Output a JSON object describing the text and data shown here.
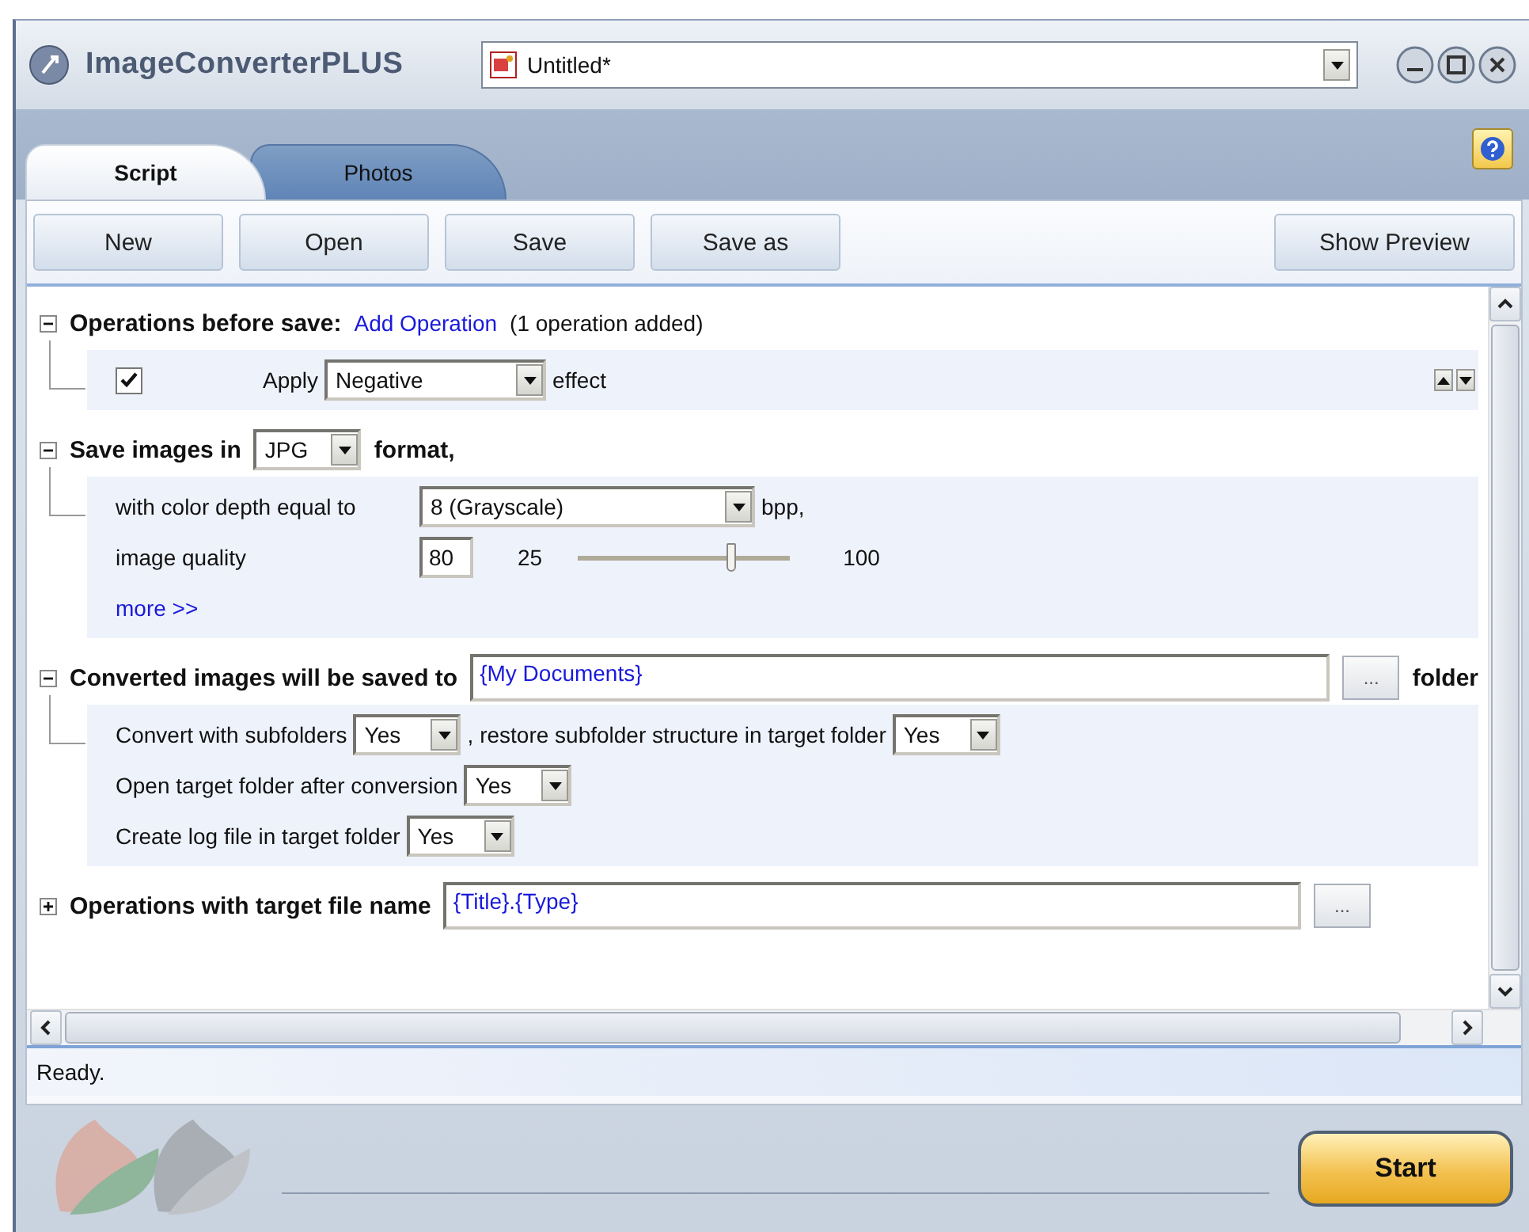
{
  "window": {
    "app_name": "ImageConverterPLUS",
    "document": "Untitled*"
  },
  "tabs": [
    {
      "label": "Script",
      "selected": true
    },
    {
      "label": "Photos",
      "selected": false
    }
  ],
  "toolbar": {
    "buttons": [
      "New",
      "Open",
      "Save",
      "Save as"
    ],
    "preview_button": "Show Preview"
  },
  "sections": [
    {
      "expanded": true,
      "header": [
        {
          "kind": "bold",
          "text": "Operations before save:"
        },
        {
          "kind": "link",
          "text": "Add Operation"
        },
        {
          "kind": "text",
          "text": "(1 operation added)"
        }
      ],
      "options": [
        {
          "items": [
            {
              "kind": "checkbox",
              "checked": true
            },
            {
              "kind": "text",
              "text": "Apply"
            },
            {
              "kind": "select",
              "value": "Negative"
            },
            {
              "kind": "text",
              "text": "effect"
            },
            {
              "kind": "reorder"
            }
          ]
        }
      ]
    },
    {
      "expanded": true,
      "header": [
        {
          "kind": "bold",
          "text": "Save images in"
        },
        {
          "kind": "select",
          "value": "JPG"
        },
        {
          "kind": "bold",
          "text": "format,"
        }
      ],
      "options": [
        {
          "items": [
            {
              "kind": "label",
              "text": "with color depth equal to"
            },
            {
              "kind": "select",
              "value": "8 (Grayscale)"
            },
            {
              "kind": "text",
              "text": "bpp,"
            }
          ]
        },
        {
          "items": [
            {
              "kind": "label",
              "text": "image quality"
            },
            {
              "kind": "input",
              "value": "80"
            },
            {
              "kind": "text",
              "text": "25"
            },
            {
              "kind": "slider",
              "level": 0.73
            },
            {
              "kind": "text",
              "text": "100"
            }
          ]
        },
        {
          "items": [
            {
              "kind": "link",
              "text": "more >>"
            }
          ]
        }
      ]
    },
    {
      "expanded": true,
      "header": [
        {
          "kind": "bold",
          "text": "Converted images will be saved to"
        },
        {
          "kind": "path",
          "value": "{My Documents}"
        },
        {
          "kind": "browse",
          "text": "..."
        },
        {
          "kind": "bold",
          "text": "folder"
        }
      ],
      "options": [
        {
          "items": [
            {
              "kind": "text",
              "text": "Convert with subfolders"
            },
            {
              "kind": "select",
              "value": "Yes"
            },
            {
              "kind": "text",
              "text": ", restore subfolder structure in target folder"
            },
            {
              "kind": "select",
              "value": "Yes"
            }
          ]
        },
        {
          "items": [
            {
              "kind": "text",
              "text": "Open target folder after conversion"
            },
            {
              "kind": "select",
              "value": "Yes"
            }
          ]
        },
        {
          "items": [
            {
              "kind": "text",
              "text": "Create log file in target folder"
            },
            {
              "kind": "select",
              "value": "Yes"
            }
          ]
        }
      ]
    },
    {
      "expanded": false,
      "header": [
        {
          "kind": "bold",
          "text": "Operations with target file name"
        },
        {
          "kind": "path",
          "value": "{Title}.{Type}"
        },
        {
          "kind": "browse",
          "text": "..."
        }
      ]
    }
  ],
  "status_bar": "Ready.",
  "start_button": "Start"
}
